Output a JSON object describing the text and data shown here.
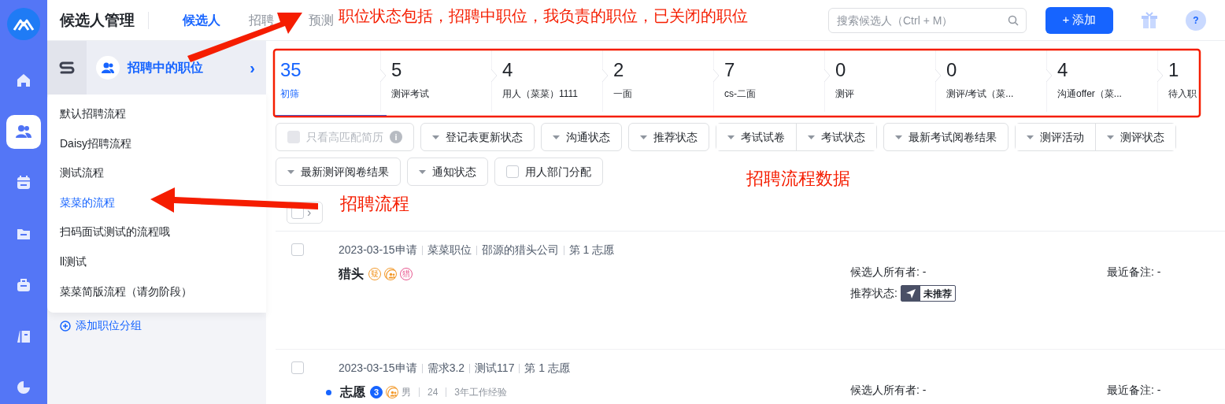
{
  "rail": [
    {
      "kind": "home",
      "selected": false
    },
    {
      "kind": "people",
      "selected": true
    },
    {
      "kind": "calendar",
      "selected": false
    },
    {
      "kind": "folder",
      "selected": false
    },
    {
      "kind": "briefcase",
      "selected": false
    },
    {
      "kind": "book",
      "selected": false
    },
    {
      "kind": "chart",
      "selected": false
    }
  ],
  "header": {
    "title": "候选人管理",
    "tabs": [
      {
        "parts": [
          "候选人"
        ],
        "selected": true
      },
      {
        "parts": [
          "招聘",
          "预测"
        ],
        "selected": false
      }
    ],
    "search": {
      "placeholder": "搜索候选人（Ctrl + M）"
    },
    "add_button": {
      "icon": "+",
      "label": "添加"
    },
    "help": "?"
  },
  "job_filter": {
    "label": "招聘中的职位",
    "chevron": "›"
  },
  "processes": [
    {
      "label": "默认招聘流程",
      "selected": false
    },
    {
      "label": "Daisy招聘流程",
      "selected": false
    },
    {
      "label": "测试流程",
      "selected": false
    },
    {
      "label": "菜菜的流程",
      "selected": true
    },
    {
      "label": "扫码面试测试的流程哦",
      "selected": false
    },
    {
      "label": "ll测试",
      "selected": false
    },
    {
      "label": "菜菜简版流程（请勿阶段）",
      "selected": false
    }
  ],
  "add_group": "添加职位分组",
  "stages": [
    {
      "count": "35",
      "label": "初筛",
      "selected": true
    },
    {
      "count": "5",
      "label": "测评考试",
      "selected": false
    },
    {
      "count": "4",
      "label": "用人（菜菜）1111",
      "selected": false
    },
    {
      "count": "2",
      "label": "一面",
      "selected": false
    },
    {
      "count": "7",
      "label": "cs-二面",
      "selected": false
    },
    {
      "count": "0",
      "label": "测评",
      "selected": false
    },
    {
      "count": "0",
      "label": "测评/考试（菜...",
      "selected": false
    },
    {
      "count": "4",
      "label": "沟通offer（菜...",
      "selected": false
    },
    {
      "count": "1",
      "label": "待入职",
      "selected": false
    }
  ],
  "filter_rows": [
    [
      {
        "kind": "checkbox",
        "label": "只看高匹配简历",
        "checked": false,
        "disabled": true,
        "info": "i"
      },
      {
        "kind": "dropdown",
        "labels": [
          "登记表更新状态"
        ]
      },
      {
        "kind": "dropdown",
        "labels": [
          "沟通状态"
        ]
      },
      {
        "kind": "dropdown",
        "labels": [
          "推荐状态"
        ]
      },
      {
        "kind": "dropdown",
        "labels": [
          "考试试卷",
          "考试状态"
        ]
      },
      {
        "kind": "dropdown",
        "labels": [
          "最新考试阅卷结果"
        ]
      },
      {
        "kind": "dropdown",
        "labels": [
          "测评活动",
          "测评状态"
        ]
      }
    ],
    [
      {
        "kind": "dropdown",
        "labels": [
          "最新测评阅卷结果"
        ]
      },
      {
        "kind": "dropdown",
        "labels": [
          "通知状态"
        ]
      },
      {
        "kind": "checkbox",
        "label": "用人部门分配",
        "checked": false,
        "disabled": false
      }
    ]
  ],
  "select_all": {
    "checked": false,
    "chevron": "›"
  },
  "candidates": [
    {
      "checked": false,
      "meta": [
        "2023-03-15申请",
        "菜菜职位",
        "邵源的猎头公司",
        "第 1 志愿"
      ],
      "name": "猎头",
      "unread": false,
      "tags": [
        {
          "kind": "text",
          "text": "疑",
          "color": "#f39a2b"
        },
        {
          "kind": "person",
          "color": "#f39a2b"
        },
        {
          "kind": "text",
          "text": "猎",
          "color": "#e8578f"
        }
      ],
      "owner": "候选人所有者: -",
      "recommend": {
        "label": "推荐状态:",
        "status": "未推荐"
      },
      "note": "最近备注: -"
    },
    {
      "checked": false,
      "meta": [
        "2023-03-15申请",
        "需求3.2",
        "测试117",
        "第 1 志愿"
      ],
      "name": "志愿",
      "unread": true,
      "tags": [
        {
          "kind": "count",
          "text": "3",
          "color": "#1664ff"
        },
        {
          "kind": "person",
          "color": "#f39a2b"
        }
      ],
      "details": [
        "男",
        "24",
        "3年工作经验"
      ],
      "owner": "候选人所有者: -",
      "note": "最近备注: -"
    }
  ],
  "annotations": [
    {
      "kind": "arrow",
      "text": "职位状态包括，招聘中职位，我负责的职位，已关闭的职位"
    },
    {
      "kind": "arrow",
      "text": "招聘流程"
    },
    {
      "kind": "box",
      "text": "招聘流程数据"
    }
  ]
}
